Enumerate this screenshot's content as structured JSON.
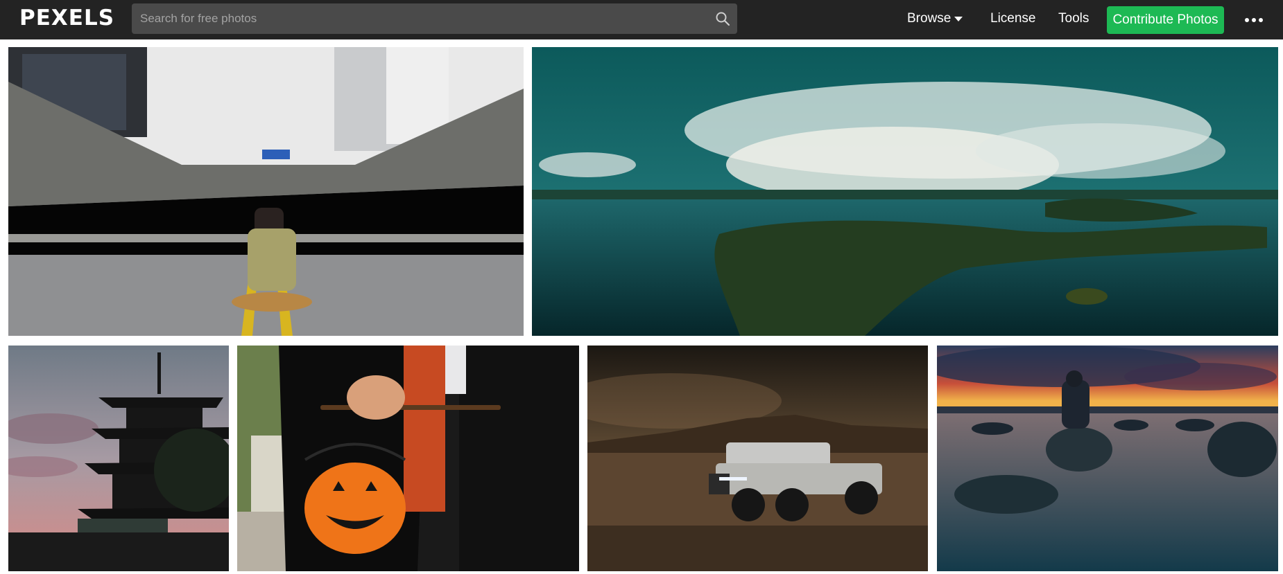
{
  "brand": {
    "logo_text": "PEXELS"
  },
  "search": {
    "placeholder": "Search for free photos",
    "value": ""
  },
  "nav": {
    "browse": "Browse",
    "license": "License",
    "tools": "Tools",
    "contribute": "Contribute Photos"
  },
  "icons": {
    "search": "search-icon",
    "browse_caret": "caret-down-icon",
    "more": "more-dots-icon"
  },
  "colors": {
    "topbar": "#232323",
    "search_bg": "#4a4a4a",
    "contribute": "#1db954"
  },
  "photos": [
    {
      "name": "photo-backpacker-tunnel-road"
    },
    {
      "name": "photo-aerial-sea-islands-clouds"
    },
    {
      "name": "photo-pagoda-sunset"
    },
    {
      "name": "photo-halloween-pumpkin-bucket"
    },
    {
      "name": "photo-truck-desert-night"
    },
    {
      "name": "photo-man-on-rock-lake-sunset"
    }
  ]
}
